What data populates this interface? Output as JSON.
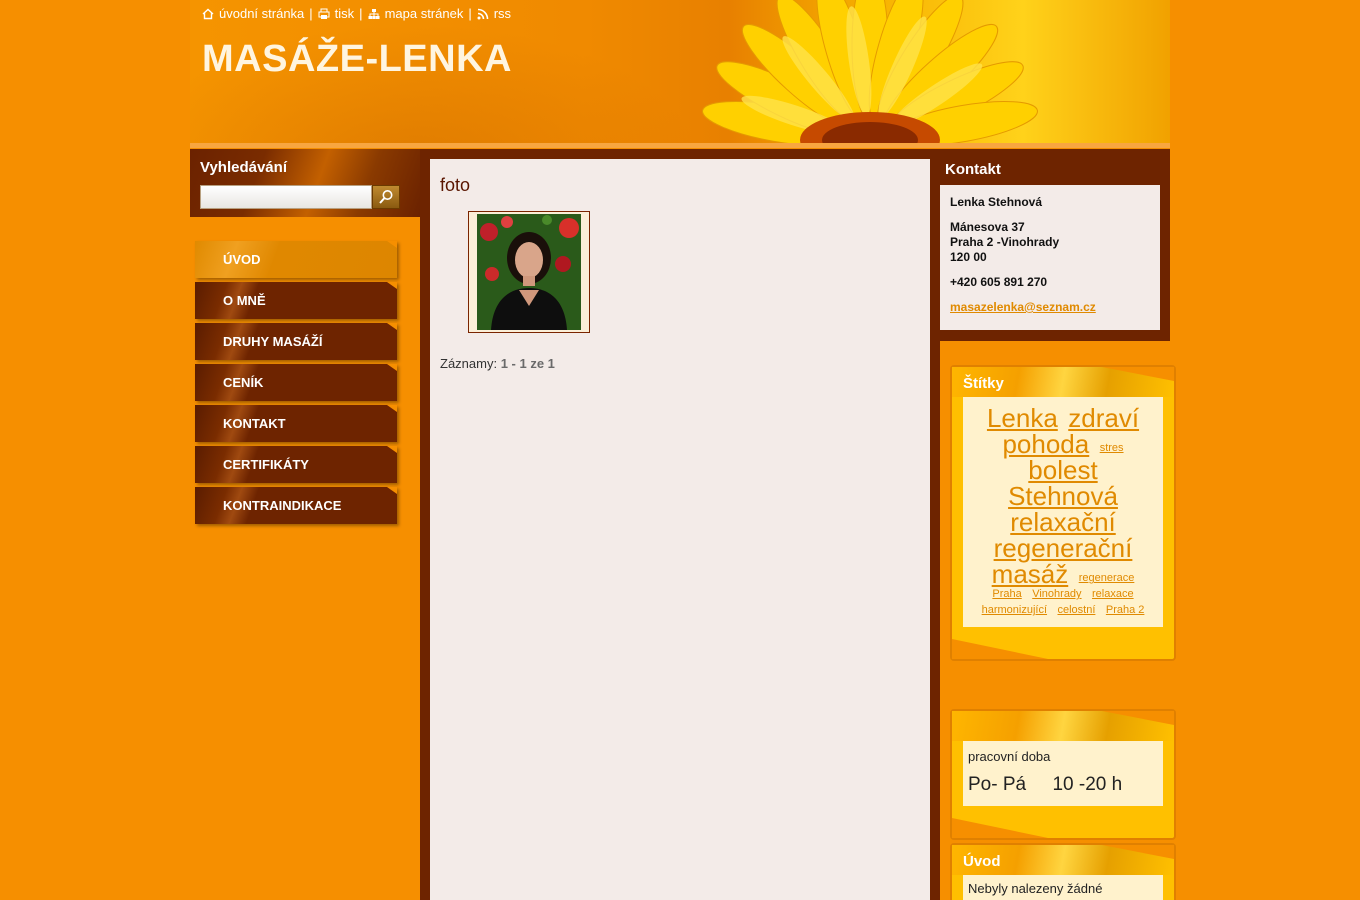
{
  "topbar": {
    "home": "úvodní stránka",
    "print": "tisk",
    "sitemap": "mapa stránek",
    "rss": "rss",
    "separator": "|"
  },
  "site": {
    "title": "MASÁŽE-LENKA"
  },
  "search": {
    "title": "Vyhledávání",
    "placeholder": ""
  },
  "menu": [
    "ÚVOD",
    "O MNĚ",
    "DRUHY MASÁŽÍ",
    "CENÍK",
    "KONTAKT",
    "CERTIFIKÁTY",
    "KONTRAINDIKACE"
  ],
  "main": {
    "heading": "foto",
    "pager_label": "Záznamy:",
    "pager_value": "1 - 1 ze 1"
  },
  "contact": {
    "title": "Kontakt",
    "name": "Lenka Stehnová",
    "street": "Mánesova 37",
    "city": "Praha 2 -Vinohrady",
    "zip": "120 00",
    "phone": "+420 605 891 270",
    "email": "masazelenka@seznam.cz"
  },
  "tags": {
    "title": "Štítky",
    "items": [
      "Lenka",
      "zdraví",
      "pohoda",
      "stres",
      "bolest",
      "Stehnová",
      "relaxační",
      "regenerační",
      "masáž",
      "regenerace",
      "Praha",
      "Vinohrady",
      "relaxace",
      "harmonizující",
      "celostní",
      "Praha 2"
    ]
  },
  "hours": {
    "label": "pracovní doba",
    "value": "Po- Pá     10 -20 h"
  },
  "uvod_panel": {
    "title": "Úvod",
    "text": "Nebyly nalezeny žádné"
  },
  "colors": {
    "background": "#f68f00",
    "dark_brown": "#6e2400",
    "link_orange": "#e08a00",
    "panel_yellow": "#ffc000"
  }
}
